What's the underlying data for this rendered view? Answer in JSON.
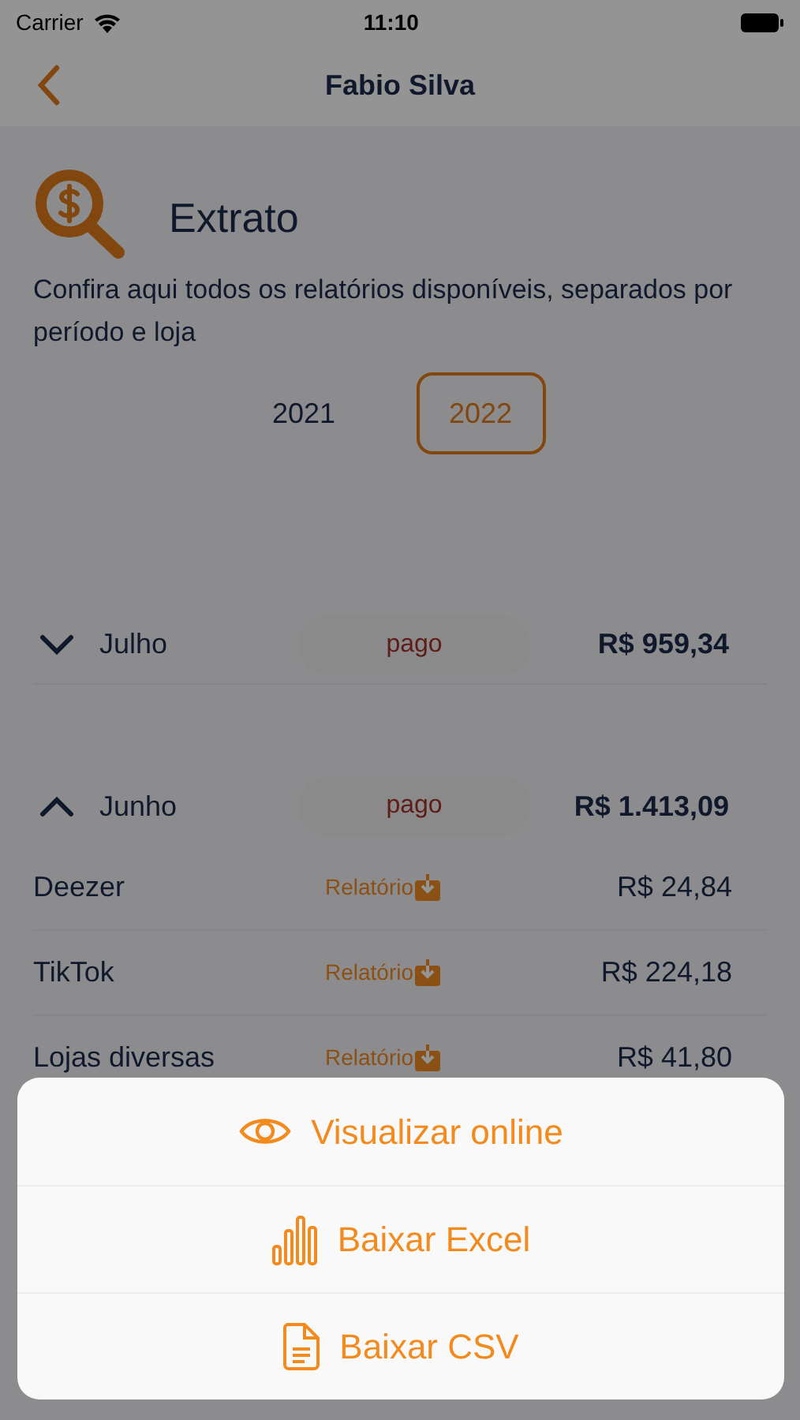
{
  "status_bar": {
    "carrier": "Carrier",
    "time": "11:10"
  },
  "nav": {
    "title": "Fabio Silva"
  },
  "header": {
    "title": "Extrato",
    "description": "Confira aqui todos os relatórios disponíveis, separados por período e loja"
  },
  "years": [
    {
      "label": "2021",
      "selected": false
    },
    {
      "label": "2022",
      "selected": true
    }
  ],
  "months": [
    {
      "name": "Julho",
      "expanded": false,
      "status": "pago",
      "total": "R$ 959,34"
    },
    {
      "name": "Junho",
      "expanded": true,
      "status": "pago",
      "total": "R$ 1.413,09",
      "stores": [
        {
          "name": "Deezer",
          "link": "Relatório",
          "amount": "R$ 24,84"
        },
        {
          "name": "TikTok",
          "link": "Relatório",
          "amount": "R$ 224,18"
        },
        {
          "name": "Lojas diversas",
          "link": "Relatório",
          "amount": "R$ 41,80"
        }
      ]
    }
  ],
  "sheet": {
    "actions": [
      {
        "kind": "view",
        "label": "Visualizar online"
      },
      {
        "kind": "excel",
        "label": "Baixar Excel"
      },
      {
        "kind": "csv",
        "label": "Baixar CSV"
      }
    ]
  }
}
